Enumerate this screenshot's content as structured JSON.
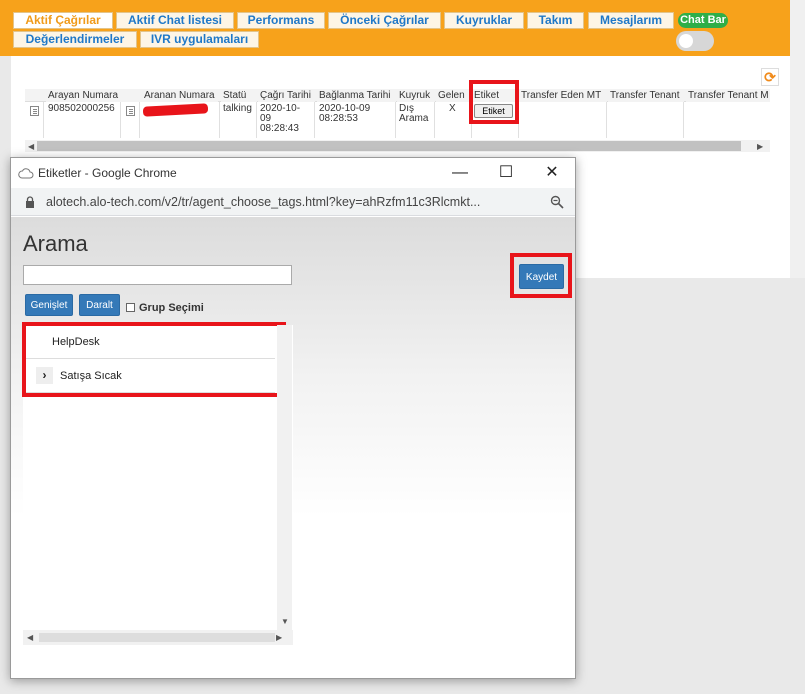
{
  "tabs_row1": [
    "Aktif Çağrılar",
    "Aktif Chat listesi",
    "Performans",
    "Önceki Çağrılar",
    "Kuyruklar",
    "Takım",
    "Mesajlarım"
  ],
  "tabs_row2": [
    "Değerlendirmeler",
    "IVR uygulamaları"
  ],
  "active_tab": "Aktif Çağrılar",
  "chat_bar_label": "Chat Bar",
  "chat_bar_enabled": false,
  "table": {
    "headers": [
      "Arayan Numara",
      "Aranan Numara",
      "Statü",
      "Çağrı Tarihi",
      "Bağlanma Tarihi",
      "Kuyruk",
      "Gelen",
      "Etiket",
      "Transfer Eden MT",
      "Transfer Tenant",
      "Transfer Tenant M"
    ],
    "row": {
      "arayan": "908502000256",
      "statu": "talking",
      "cagri_tarihi_1": "2020-10-",
      "cagri_tarihi_2": "09",
      "cagri_tarihi_3": "08:28:43",
      "baglanma_tarihi_1": "2020-10-09",
      "baglanma_tarihi_2": "08:28:53",
      "kuyruk_1": "Dış",
      "kuyruk_2": "Arama",
      "gelen": "X",
      "etiket_button": "Etiket"
    }
  },
  "popup": {
    "window_title": "Etiketler - Google Chrome",
    "url": "alotech.alo-tech.com/v2/tr/agent_choose_tags.html?key=ahRzfm11c3Rlcmkt...",
    "heading": "Arama",
    "search_value": "",
    "genislet_label": "Genişlet",
    "daralt_label": "Daralt",
    "grup_secimi_label": "Grup Seçimi",
    "kaydet_label": "Kaydet",
    "tree_items": [
      {
        "label": "HelpDesk",
        "expandable": false
      },
      {
        "label": "Satışa Sıcak",
        "expandable": true
      }
    ]
  },
  "colors": {
    "topbar": "#f7a21b",
    "tab_text": "#1f78c8",
    "active_tab_text": "#f09b1a",
    "primary_button": "#3479b8",
    "highlight_box": "#e8141a",
    "chat_bar": "#2fae48"
  }
}
